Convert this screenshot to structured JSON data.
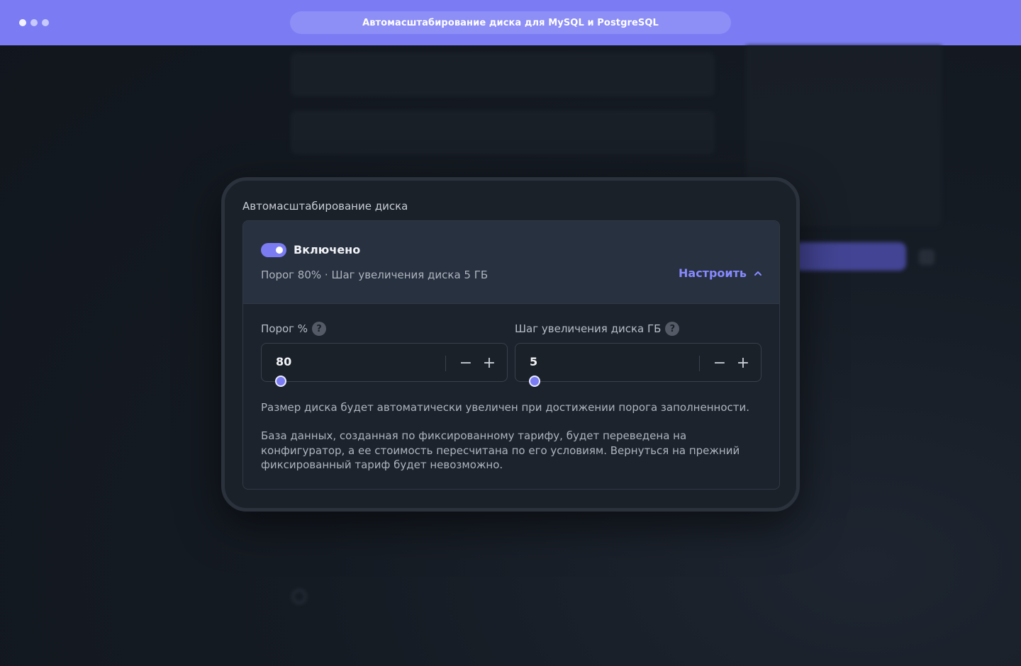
{
  "window": {
    "title": "Автомасштабирование диска для MySQL и PostgreSQL"
  },
  "dialog": {
    "title": "Автомасштабирование диска",
    "toggle": {
      "label": "Включено",
      "on": true
    },
    "summary": "Порог 80% · Шаг увеличения диска 5 ГБ",
    "configure_label": "Настроить",
    "threshold": {
      "label": "Порог %",
      "value": "80",
      "help": "?"
    },
    "step": {
      "label": "Шаг увеличения диска ГБ",
      "value": "5",
      "help": "?"
    },
    "stepper_minus": "−",
    "stepper_plus": "+",
    "note1": "Размер диска будет автоматически увеличен при достижении порога заполненности.",
    "note2": "База данных, созданная по фиксированному тарифу, будет переведена на конфигуратор, а ее стоимость пересчитана по его условиям. Вернуться на прежний фиксированный тариф будет невозможно."
  },
  "colors": {
    "accent": "#7b7cf3",
    "link": "#8789ff",
    "topbar": "#7b7cf3",
    "background": "#151b23",
    "dialog": "#1b2129"
  },
  "icons": {
    "help": "help-circle-icon",
    "chevron": "chevron-up-icon",
    "minus": "minus-icon",
    "plus": "plus-icon"
  }
}
